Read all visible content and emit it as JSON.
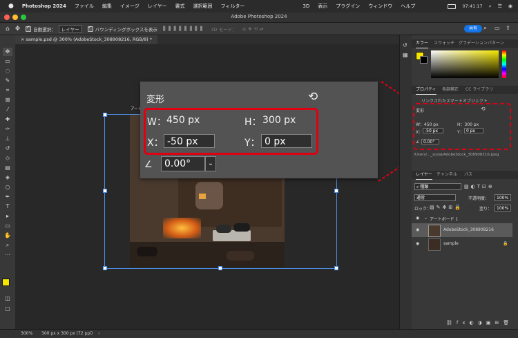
{
  "menubar": {
    "apple": "",
    "app_name": "Photoshop 2024",
    "items": [
      "ファイル",
      "編集",
      "イメージ",
      "レイヤー",
      "書式",
      "選択範囲",
      "フィルター",
      "3D",
      "表示",
      "プラグイン",
      "ウィンドウ",
      "ヘルプ"
    ],
    "clock": "07:41:17"
  },
  "window": {
    "title": "Adobe Photoshop 2024"
  },
  "options_bar": {
    "auto_select": "自動選択：",
    "auto_select_value": "レイヤー",
    "bounding_box": "バウンディングボックスを表示",
    "mode_3d": "3D モード：",
    "share": "共有"
  },
  "document": {
    "tab": "sample.psd @ 300% (AdobeStock_308908216, RGB/8) *",
    "artboard_label": "アート"
  },
  "transform_panel": {
    "title": "変形",
    "w_label": "W：",
    "w_value": "450 px",
    "h_label": "H：",
    "h_value": "300 px",
    "x_label": "X：",
    "x_value": "-50 px",
    "y_label": "Y：",
    "y_value": "0 px",
    "angle_value": "0.00°"
  },
  "status_bar": {
    "zoom": "300%",
    "doc_info": "300 px x 300 px (72 ppi)"
  },
  "color_panel": {
    "tabs": [
      "カラー",
      "スウォッチ",
      "グラデーション",
      "パターン"
    ]
  },
  "properties_panel": {
    "tabs": [
      "プロパティ",
      "色調補正",
      "CC ライブラリ"
    ],
    "smart_object": "リンクされたスマートオブジェクト",
    "section": "変形",
    "w": "W：450 px",
    "h": "H：300 px",
    "x_label": "X：",
    "x_value": "-50 px",
    "y_label": "Y：",
    "y_value": "0 px",
    "angle": "0.00°",
    "path": "/Users/..._sozai/AdobeStock_308908216.jpeg"
  },
  "layers_panel": {
    "tabs": [
      "レイヤー",
      "チャンネル",
      "パス"
    ],
    "filter_kind": "種類",
    "blend_mode": "通常",
    "opacity_label": "不透明度：",
    "opacity_value": "100%",
    "lock_label": "ロック：",
    "fill_label": "塗り：",
    "fill_value": "100%",
    "layers": [
      {
        "name": "アートボード 1"
      },
      {
        "name": "AdobeStock_308908216"
      },
      {
        "name": "sample"
      }
    ]
  },
  "colors": {
    "accent_red": "#e00012",
    "foreground": "#f5e600",
    "selection_blue": "#4d8fe6"
  }
}
